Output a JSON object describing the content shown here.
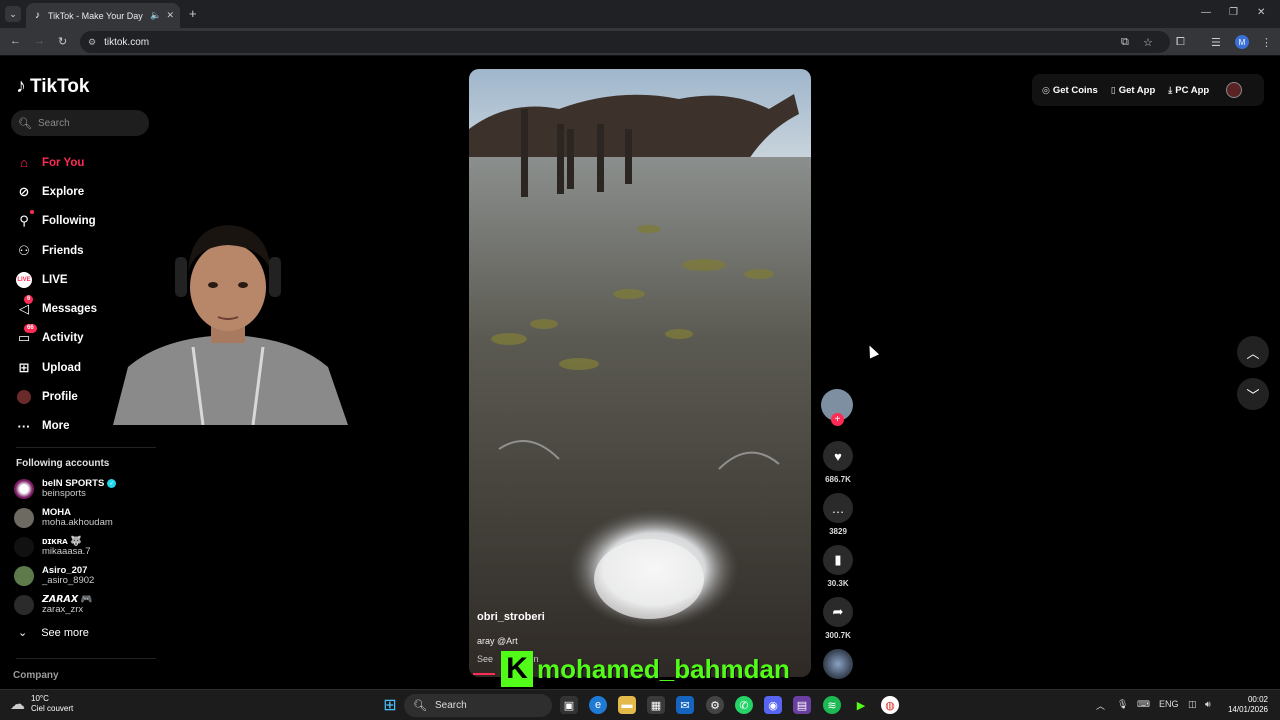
{
  "browser": {
    "tab_title": "TikTok - Make Your Day",
    "url": "tiktok.com",
    "profile_initial": "M"
  },
  "sidebar": {
    "logo": "TikTok",
    "search_placeholder": "Search",
    "nav": [
      {
        "label": "For You",
        "icon": "home-icon",
        "active": true
      },
      {
        "label": "Explore",
        "icon": "compass-icon"
      },
      {
        "label": "Following",
        "icon": "following-icon"
      },
      {
        "label": "Friends",
        "icon": "friends-icon"
      },
      {
        "label": "LIVE",
        "icon": "live-icon"
      },
      {
        "label": "Messages",
        "icon": "messages-icon",
        "badge": "6"
      },
      {
        "label": "Activity",
        "icon": "activity-icon",
        "badge": "66"
      },
      {
        "label": "Upload",
        "icon": "upload-icon"
      },
      {
        "label": "Profile",
        "icon": "profile-icon"
      },
      {
        "label": "More",
        "icon": "more-icon"
      }
    ],
    "following_title": "Following accounts",
    "following": [
      {
        "name": "beIN SPORTS",
        "handle": "beinsports",
        "verified": true
      },
      {
        "name": "MOHA",
        "handle": "moha.akhoudam"
      },
      {
        "name": "ᴅɪᴋʀᴀ 🐺",
        "handle": "mikaaasa.7"
      },
      {
        "name": "Asiro_207",
        "handle": "_asiro_8902"
      },
      {
        "name": "𝙕𝘼𝙍𝘼𝙓 🎮",
        "handle": "zarax_zrx"
      }
    ],
    "see_more": "See more",
    "company": "Company"
  },
  "video": {
    "username": "obri_stroberi",
    "description": "aray @Art",
    "see_more": "See",
    "see_more_tail": "n"
  },
  "actions": {
    "likes": "686.7K",
    "comments": "3829",
    "saves": "30.3K",
    "shares": "300.7K"
  },
  "topbar": {
    "get_coins": "Get Coins",
    "get_app": "Get App",
    "pc_app": "PC App"
  },
  "overlay": {
    "streamer_badge": "K",
    "streamer_name": "mohamed_bahmdan"
  },
  "taskbar": {
    "temperature": "10°C",
    "weather": "Ciel couvert",
    "search": "Search",
    "lang": "ENG",
    "time": "00:02",
    "date": "14/01/2026"
  },
  "colors": {
    "accent": "#fe2c55",
    "kick_green": "#53fc18"
  }
}
